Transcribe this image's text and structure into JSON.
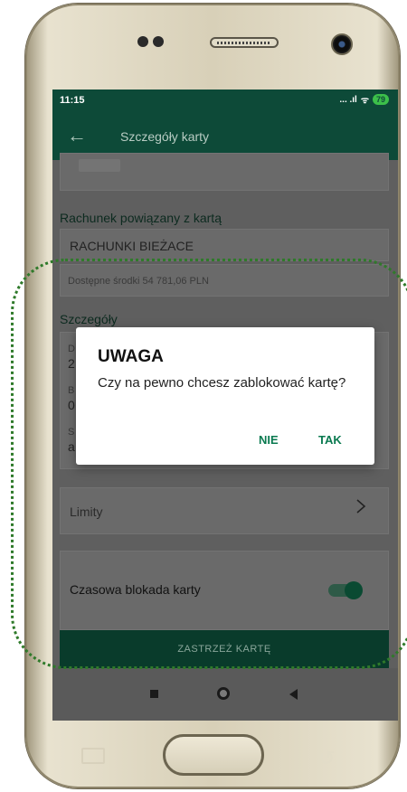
{
  "status": {
    "time": "11:15",
    "signal": "... .ıl",
    "wifi": "ᯤ",
    "battery": "79"
  },
  "appbar": {
    "title": "Szczegóły karty"
  },
  "account": {
    "section_label": "Rachunek powiązany z kartą",
    "name": "RACHUNKI BIEŻACE",
    "balance": "Dostępne środki 54 781,06 PLN"
  },
  "details": {
    "section_label": "Szczegóły",
    "rows": [
      {
        "label": "D",
        "value": "2"
      },
      {
        "label": "B",
        "value": "0"
      },
      {
        "label": "S",
        "value": "a"
      }
    ]
  },
  "limits": {
    "label": "Limity"
  },
  "temp_block": {
    "label": "Czasowa blokada karty",
    "enabled": true
  },
  "bottom_button": {
    "label": "ZASTRZEŻ KARTĘ"
  },
  "dialog": {
    "title": "UWAGA",
    "message": "Czy na pewno chcesz zablokować kartę?",
    "no_label": "NIE",
    "yes_label": "TAK"
  },
  "colors": {
    "header": "#0d4a38",
    "accent": "#0a7a50",
    "annotation": "#2f7a2a"
  }
}
